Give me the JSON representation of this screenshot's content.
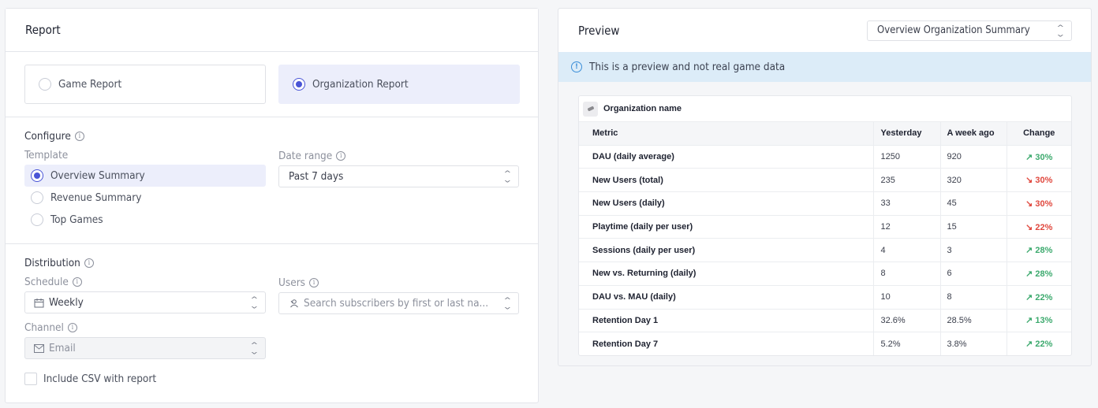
{
  "report_panel": {
    "title": "Report",
    "report_types": [
      {
        "label": "Game Report",
        "selected": false
      },
      {
        "label": "Organization Report",
        "selected": true
      }
    ],
    "configure": {
      "title": "Configure",
      "template_label": "Template",
      "templates": [
        {
          "label": "Overview Summary",
          "selected": true
        },
        {
          "label": "Revenue Summary",
          "selected": false
        },
        {
          "label": "Top Games",
          "selected": false
        }
      ],
      "date_range_label": "Date range",
      "date_range_value": "Past 7 days"
    },
    "distribution": {
      "title": "Distribution",
      "schedule_label": "Schedule",
      "schedule_value": "Weekly",
      "users_label": "Users",
      "users_placeholder": "Search subscribers by first or last na...",
      "channel_label": "Channel",
      "channel_value": "Email",
      "include_csv_label": "Include CSV with report",
      "include_csv_checked": false
    }
  },
  "preview_panel": {
    "title": "Preview",
    "template_select_value": "Overview Organization Summary",
    "notice": "This is a preview and not real game data",
    "table": {
      "org_name": "Organization name",
      "columns": [
        "Metric",
        "Yesterday",
        "A week ago",
        "Change"
      ],
      "rows": [
        {
          "metric": "DAU (daily average)",
          "yesterday": "1250",
          "week_ago": "920",
          "change": "↗ 30%",
          "direction": "up"
        },
        {
          "metric": "New Users (total)",
          "yesterday": "235",
          "week_ago": "320",
          "change": "↘ 30%",
          "direction": "down"
        },
        {
          "metric": "New Users (daily)",
          "yesterday": "33",
          "week_ago": "45",
          "change": "↘ 30%",
          "direction": "down"
        },
        {
          "metric": "Playtime (daily per user)",
          "yesterday": "12",
          "week_ago": "15",
          "change": "↘ 22%",
          "direction": "down"
        },
        {
          "metric": "Sessions (daily per user)",
          "yesterday": "4",
          "week_ago": "3",
          "change": "↗ 28%",
          "direction": "up"
        },
        {
          "metric": "New vs. Returning (daily)",
          "yesterday": "8",
          "week_ago": "6",
          "change": "↗ 28%",
          "direction": "up"
        },
        {
          "metric": "DAU vs. MAU (daily)",
          "yesterday": "10",
          "week_ago": "8",
          "change": "↗ 22%",
          "direction": "up"
        },
        {
          "metric": "Retention Day 1",
          "yesterday": "32.6%",
          "week_ago": "28.5%",
          "change": "↗ 13%",
          "direction": "up"
        },
        {
          "metric": "Retention Day 7",
          "yesterday": "5.2%",
          "week_ago": "3.8%",
          "change": "↗ 22%",
          "direction": "up"
        }
      ]
    }
  },
  "colors": {
    "accent": "#4a55d6",
    "selected_bg": "#eceefb",
    "notice_bg": "#dcecf8",
    "change_up": "#3daa6e",
    "change_down": "#e0483e"
  }
}
